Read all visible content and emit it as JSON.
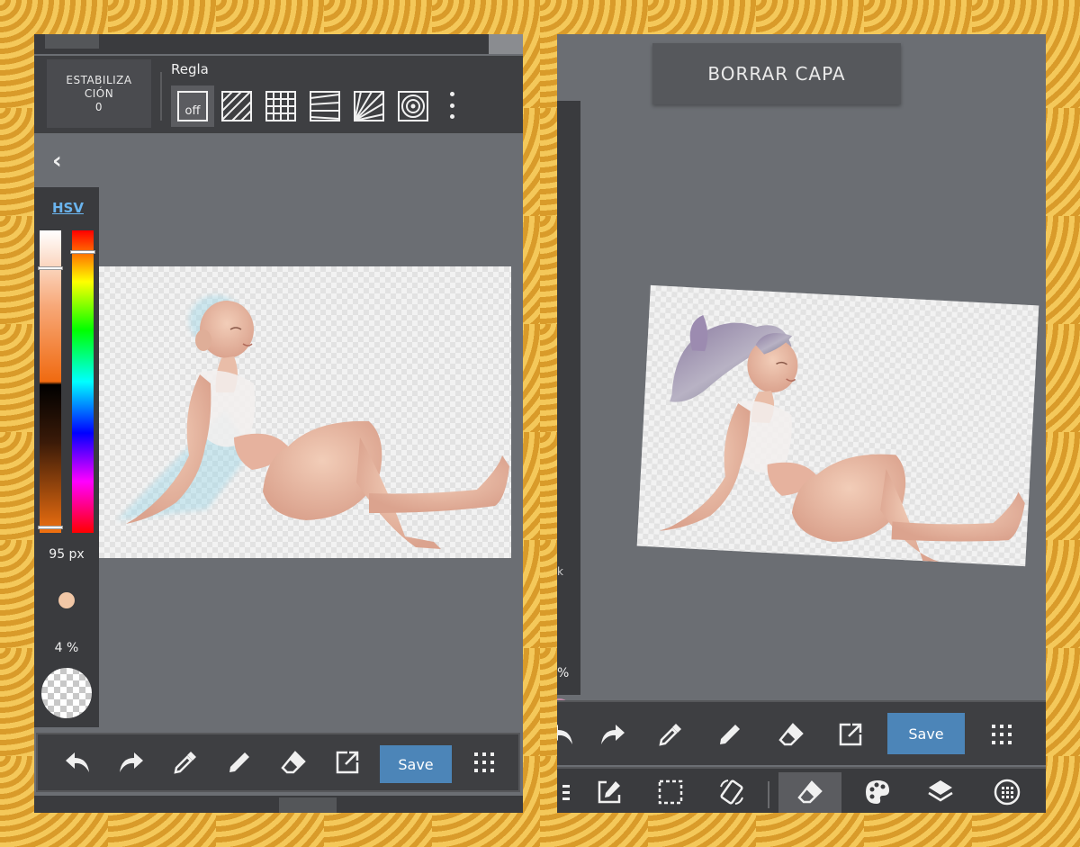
{
  "left": {
    "stabilization": {
      "line1": "ESTABILIZA",
      "line2": "CIÓN",
      "value": "0"
    },
    "ruler": {
      "title": "Regla",
      "off_label": "off"
    },
    "color": {
      "mode_link": "HSV",
      "brush_size": "95 px",
      "opacity": "4 %",
      "brush_color": "#f1c7a6"
    },
    "bottom_toolbar": {
      "save_label": "Save"
    }
  },
  "right": {
    "clear_layer_label": "BORRAR CAPA",
    "side_percent": "%",
    "side_mark": "k",
    "bottom_toolbar": {
      "save_label": "Save"
    },
    "accent_color": "#c48aa8"
  },
  "colors": {
    "save": "#4c85b8",
    "hsv_link": "#6ab4ee"
  }
}
